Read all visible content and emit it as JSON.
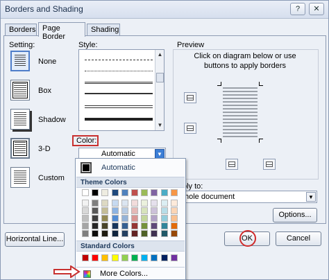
{
  "window": {
    "title": "Borders and Shading",
    "help_button": "?",
    "close_button": "✕"
  },
  "tabs": [
    {
      "label": "Borders"
    },
    {
      "label": "Page Border"
    },
    {
      "label": "Shading"
    }
  ],
  "setting": {
    "heading": "Setting:",
    "items": [
      {
        "label": "None"
      },
      {
        "label": "Box"
      },
      {
        "label": "Shadow"
      },
      {
        "label": "3-D"
      },
      {
        "label": "Custom"
      }
    ]
  },
  "style": {
    "heading": "Style:"
  },
  "color": {
    "label": "Color:",
    "value": "Automatic"
  },
  "preview": {
    "heading": "Preview",
    "instructions": "Click on diagram below or use buttons to apply borders"
  },
  "apply": {
    "label": "ply to:",
    "value": "hole document"
  },
  "buttons": {
    "options": "Options...",
    "ok": "OK",
    "cancel": "Cancel",
    "horizontal_line": "Horizontal Line..."
  },
  "color_menu": {
    "automatic_label": "Automatic",
    "theme_heading": "Theme Colors",
    "standard_heading": "Standard Colors",
    "more_colors": "More Colors...",
    "theme_top": [
      "#ffffff",
      "#000000",
      "#eeece1",
      "#1f497d",
      "#4f81bd",
      "#c0504d",
      "#9bbb59",
      "#8064a2",
      "#4bacc6",
      "#f79646"
    ],
    "theme_cols": [
      [
        "#f2f2f2",
        "#d8d8d8",
        "#bfbfbf",
        "#a5a5a5",
        "#7f7f7f"
      ],
      [
        "#7f7f7f",
        "#595959",
        "#3f3f3f",
        "#262626",
        "#0c0c0c"
      ],
      [
        "#ddd9c3",
        "#c4bd97",
        "#938953",
        "#494429",
        "#1d1b10"
      ],
      [
        "#c6d9f0",
        "#8db3e2",
        "#548dd4",
        "#17365d",
        "#0f243e"
      ],
      [
        "#dbe5f1",
        "#b8cce4",
        "#95b3d7",
        "#366092",
        "#244061"
      ],
      [
        "#f2dcdb",
        "#e5b9b7",
        "#d99694",
        "#953734",
        "#632423"
      ],
      [
        "#ebf1dd",
        "#d7e3bc",
        "#c3d69b",
        "#76923c",
        "#4f6128"
      ],
      [
        "#e5e0ec",
        "#ccc1d9",
        "#b2a2c7",
        "#5f497a",
        "#3f3151"
      ],
      [
        "#dbeef3",
        "#b7dde8",
        "#92cddc",
        "#31859b",
        "#205867"
      ],
      [
        "#fdeada",
        "#fbd5b5",
        "#fac08f",
        "#e36c09",
        "#974806"
      ]
    ],
    "standard": [
      "#c00000",
      "#ff0000",
      "#ffc000",
      "#ffff00",
      "#92d050",
      "#00b050",
      "#00b0f0",
      "#0070c0",
      "#002060",
      "#7030a0"
    ]
  }
}
